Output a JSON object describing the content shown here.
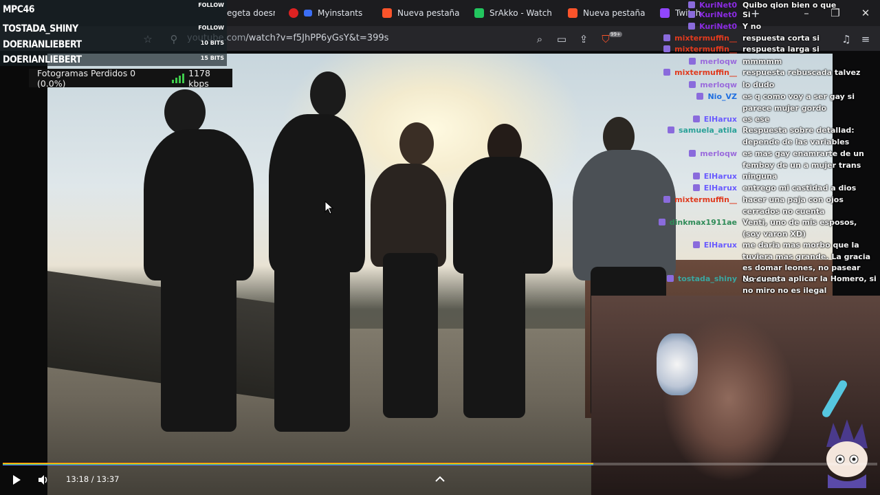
{
  "browser": {
    "tabs": [
      {
        "label": "egeta doesn't",
        "fav_color": "#1c1c1f"
      },
      {
        "label": "Myinstants | #",
        "fav_color": "#d22"
      },
      {
        "label": "Nueva pestaña",
        "fav_color": "#fb542b"
      },
      {
        "label": "SrAkko - Watch cl",
        "fav_color": "#22c55e"
      },
      {
        "label": "Nueva pestaña",
        "fav_color": "#fb542b"
      },
      {
        "label": "Twitch",
        "fav_color": "#9146ff"
      }
    ],
    "new_tab": "+",
    "url_host": "youtube.com",
    "url_path": "/watch?v=f5JhPP6yGsY&t=399s",
    "shield_count": "99+"
  },
  "alerts": {
    "rows": [
      {
        "name": "MPC46",
        "tag": "FOLLOW"
      },
      {
        "name": "TOSTADA_SHINY",
        "tag": "FOLLOW"
      },
      {
        "name": "DOERIANLIEBERT",
        "tag": "10 BITS"
      },
      {
        "name": "DOERIANLIEBERT",
        "tag": "15 BITS"
      }
    ]
  },
  "stats": {
    "frames_label": "Fotogramas Perdidos 0 (0.0%)",
    "bitrate": "1178 kbps"
  },
  "chat": {
    "messages": [
      {
        "user": "KuriNet0",
        "color": "#8a2be2",
        "text": "Quibo qion bien o que"
      },
      {
        "user": "KuriNet0",
        "color": "#8a2be2",
        "text": "Si"
      },
      {
        "user": "KuriNet0",
        "color": "#8a2be2",
        "text": "Y no"
      },
      {
        "user": "mixtermuffin__",
        "color": "#e03a1e",
        "text": "respuesta corta si"
      },
      {
        "user": "mixtermuffin__",
        "color": "#e03a1e",
        "text": "respuesta larga si"
      },
      {
        "user": "merloqw",
        "color": "#9a6bdc",
        "text": "mmmmm"
      },
      {
        "user": "mixtermuffin__",
        "color": "#e03a1e",
        "text": "respuesta rebuscada talvez"
      },
      {
        "user": "merloqw",
        "color": "#9a6bdc",
        "text": "lo dudo"
      },
      {
        "user": "Nio_VZ",
        "color": "#1f6fe0",
        "text": "es q como voy a ser gay si parece mujer gordo"
      },
      {
        "user": "ElHarux",
        "color": "#6a5cff",
        "text": "es ese"
      },
      {
        "user": "samuela_atila",
        "color": "#2aa198",
        "text": "Respuesta sobre detallad: depende de las variables"
      },
      {
        "user": "merloqw",
        "color": "#9a6bdc",
        "text": "es mas gay enamrarte de un femboy de un a mujer trans"
      },
      {
        "user": "ElHarux",
        "color": "#6a5cff",
        "text": "ninguna"
      },
      {
        "user": "ElHarux",
        "color": "#6a5cff",
        "text": "entrego mi castidad a dios"
      },
      {
        "user": "mixtermuffin__",
        "color": "#e03a1e",
        "text": "hacer una paja con ojos cerrados no cuenta"
      },
      {
        "user": "dinkmax1911ae",
        "color": "#2e8b57",
        "text": "Venti, uno de mis esposos, (soy varon XD)"
      },
      {
        "user": "ElHarux",
        "color": "#6a5cff",
        "text": "me daria mas morbo que la tuviera mas grande. La gracia es domar leones, no pasear corderos"
      },
      {
        "user": "tostada_shiny",
        "color": "#3aa6a0",
        "text": "No cuenta aplicar la Homero, si no miro no es ilegal"
      }
    ]
  },
  "player": {
    "current_time": "13:18",
    "duration": "13:37",
    "time_label": "13:18 / 13:37",
    "progress": 0.973,
    "watched_bar_fraction": 0.675
  },
  "colors": {
    "progress_red": "#ff2a2a",
    "bitrate_green": "#3fcc4c"
  }
}
